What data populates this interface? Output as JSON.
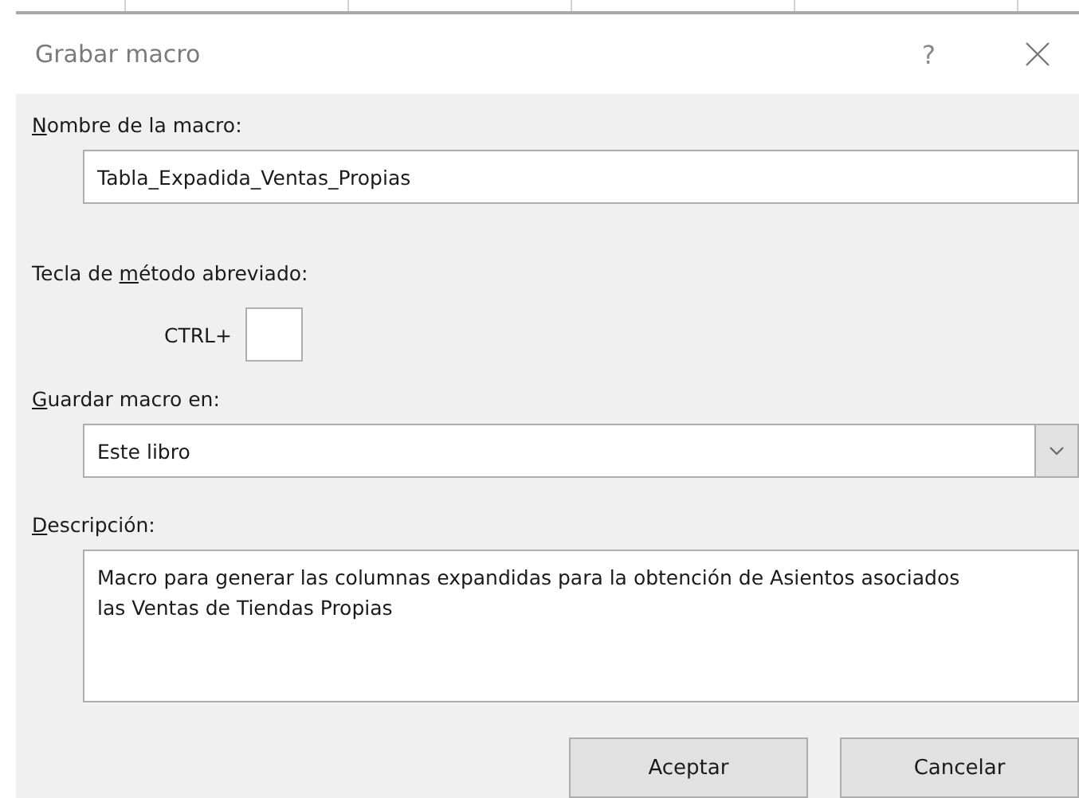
{
  "window": {
    "title": "Grabar macro",
    "help": "?"
  },
  "macro_name": {
    "label": {
      "key": "N",
      "after": "ombre de la macro:"
    },
    "value": "Tabla_Expadida_Ventas_Propias"
  },
  "shortcut": {
    "label": {
      "before": "Tecla de ",
      "key": "m",
      "after": "étodo abreviado:"
    },
    "prefix": "CTRL+"
  },
  "store_in": {
    "label": {
      "key": "G",
      "after": "uardar macro en:"
    },
    "value": "Este libro"
  },
  "description": {
    "label": {
      "key": "D",
      "after": "escripción:"
    },
    "value": "Macro para generar las columnas expandidas para la obtención de Asientos asociados  las Ventas de Tiendas Propias"
  },
  "buttons": [
    {
      "label": "Aceptar"
    },
    {
      "label": "Cancelar"
    }
  ]
}
